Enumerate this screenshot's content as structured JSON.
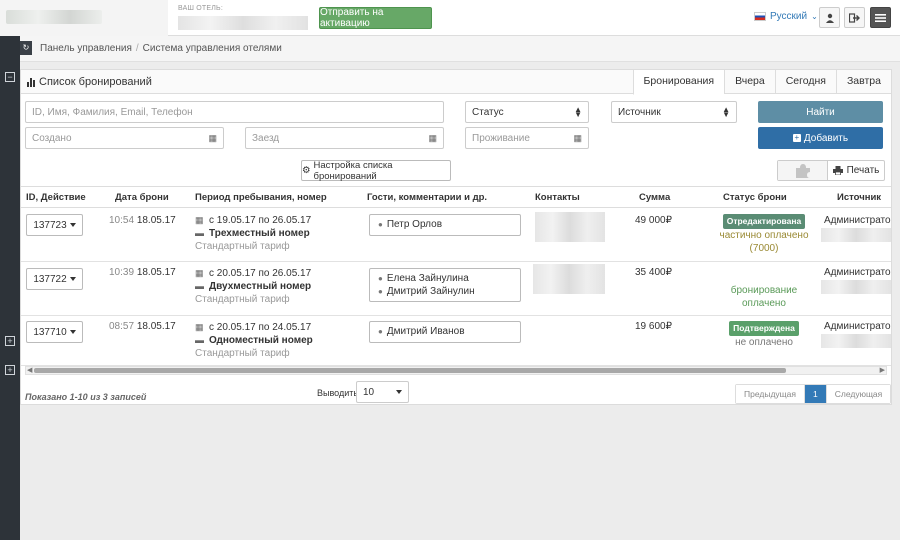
{
  "topbar": {
    "hotel_label": "ВАШ ОТЕЛЬ:",
    "activate_button": "Отправить на активацию",
    "language": "Русский",
    "icons": [
      "user-icon",
      "sign-out-icon",
      "menu-icon"
    ]
  },
  "breadcrumb": {
    "items": [
      "Панель управления",
      "Система управления отелями"
    ]
  },
  "panel": {
    "title": "Список бронирований",
    "tabs": [
      "Бронирования",
      "Вчера",
      "Сегодня",
      "Завтра"
    ],
    "active_tab": "Бронирования"
  },
  "filters": {
    "search_placeholder": "ID, Имя, Фамилия, Email, Телефон",
    "status_placeholder": "Статус",
    "source_placeholder": "Источник",
    "created_placeholder": "Создано",
    "arrival_placeholder": "Заезд",
    "stay_placeholder": "Проживание",
    "find_button": "Найти",
    "add_button": "Добавить"
  },
  "toolbar": {
    "config_button": "Настройка списка бронирований",
    "print_button": "Печать"
  },
  "table": {
    "columns": [
      "ID, Действие",
      "Дата брони",
      "Период пребывания, номер",
      "Гости, комментарии и др.",
      "Контакты",
      "Сумма",
      "Статус брони",
      "Источник"
    ],
    "rows": [
      {
        "id": "137723",
        "time": "10:54",
        "date": "18.05.17",
        "period": "с 19.05.17 по 26.05.17",
        "room": "Трехместный номер",
        "tariff": "Стандартный тариф",
        "guests": [
          "Петр Орлов"
        ],
        "sum": "49 000₽",
        "status_badge": "Отредактирована",
        "status_line1": "частично оплачено",
        "status_line2": "(7000)",
        "source": "Администратор"
      },
      {
        "id": "137722",
        "time": "10:39",
        "date": "18.05.17",
        "period": "с 20.05.17 по 26.05.17",
        "room": "Двухместный номер",
        "tariff": "Стандартный тариф",
        "guests": [
          "Елена Зайнулина",
          "Дмитрий Зайнулин"
        ],
        "sum": "35 400₽",
        "status_badge": "",
        "status_line1": "бронирование",
        "status_line2": "оплачено",
        "source": "Администратор"
      },
      {
        "id": "137710",
        "time": "08:57",
        "date": "18.05.17",
        "period": "с 20.05.17 по 24.05.17",
        "room": "Одноместный номер",
        "tariff": "Стандартный тариф",
        "guests": [
          "Дмитрий Иванов"
        ],
        "sum": "19 600₽",
        "status_badge": "Подтверждена",
        "status_line1": "не оплачено",
        "status_line2": "",
        "source": "Администратор"
      }
    ]
  },
  "footer": {
    "shown_text": "Показано 1-10 из 3 записей",
    "per_page_label": "Выводить",
    "per_page_value": "10",
    "prev": "Предыдущая",
    "current_page": "1",
    "next": "Следующая"
  },
  "colors": {
    "activate_green": "#67a867",
    "find_blue": "#5e8ea5",
    "add_blue": "#2f6ea6",
    "badge_green": "#5a9a73",
    "rail_dark": "#2d3339"
  }
}
